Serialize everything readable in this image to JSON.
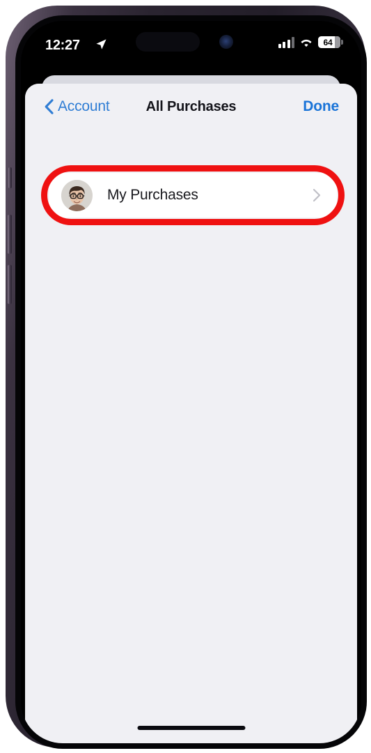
{
  "device": {
    "frame_color": "#342c3c",
    "screen_background": "#000000"
  },
  "status_bar": {
    "time": "12:27",
    "location_icon": "location-arrow-icon",
    "signal_icon": "cellular-signal-icon",
    "signal_bars_filled": 3,
    "signal_bars_total": 4,
    "wifi_icon": "wifi-icon",
    "battery_icon": "battery-icon",
    "battery_percent": "64"
  },
  "nav_bar": {
    "back_icon": "chevron-left-icon",
    "back_label": "Account",
    "title": "All Purchases",
    "done_label": "Done"
  },
  "content": {
    "sheet_background": "#f0f0f4",
    "rows": [
      {
        "avatar": "user-avatar-photo",
        "label": "My Purchases",
        "disclosure_icon": "chevron-right-icon"
      }
    ]
  },
  "annotation": {
    "shape": "rounded-rectangle-highlight",
    "color": "#ef1111",
    "target": "My Purchases"
  },
  "home_indicator": {
    "name": "home-indicator-bar"
  }
}
